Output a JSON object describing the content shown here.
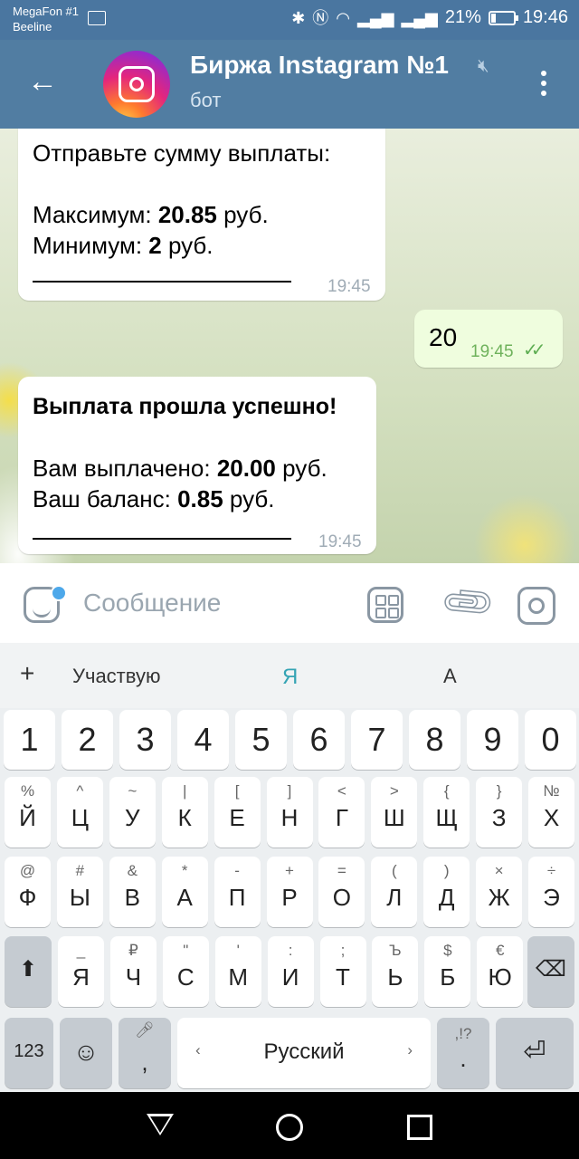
{
  "status_bar": {
    "carrier1": "MegaFon #1",
    "carrier2": "Beeline",
    "battery": "21%",
    "time": "19:46"
  },
  "header": {
    "title": "Биржа Instagram №1",
    "subtitle": "бот"
  },
  "messages": [
    {
      "from": "bot",
      "lines": [
        "Отправьте сумму выплаты:"
      ],
      "max_label": "Максимум: ",
      "max_value": "20.85",
      "min_label": "Минимум: ",
      "min_value": "2",
      "currency": " руб.",
      "time": "19:45"
    },
    {
      "from": "me",
      "text": "20",
      "time": "19:45"
    },
    {
      "from": "bot",
      "title": "Выплата прошла успешно!",
      "paid_label": "Вам выплачено: ",
      "paid_value": "20.00",
      "balance_label": "Ваш баланс: ",
      "balance_value": "0.85",
      "currency": " руб.",
      "time": "19:45"
    }
  ],
  "input": {
    "placeholder": "Сообщение"
  },
  "keyboard": {
    "suggestions": [
      "+",
      "Участвую",
      "Я",
      "А"
    ],
    "row_numbers": [
      "1",
      "2",
      "3",
      "4",
      "5",
      "6",
      "7",
      "8",
      "9",
      "0"
    ],
    "row1": [
      {
        "hint": "%",
        "key": "Й"
      },
      {
        "hint": "^",
        "key": "Ц"
      },
      {
        "hint": "~",
        "key": "У"
      },
      {
        "hint": "|",
        "key": "К"
      },
      {
        "hint": "[",
        "key": "Е"
      },
      {
        "hint": "]",
        "key": "Н"
      },
      {
        "hint": "<",
        "key": "Г"
      },
      {
        "hint": ">",
        "key": "Ш"
      },
      {
        "hint": "{",
        "key": "Щ"
      },
      {
        "hint": "}",
        "key": "З"
      },
      {
        "hint": "№",
        "key": "Х"
      }
    ],
    "row2": [
      {
        "hint": "@",
        "key": "Ф"
      },
      {
        "hint": "#",
        "key": "Ы"
      },
      {
        "hint": "&",
        "key": "В"
      },
      {
        "hint": "*",
        "key": "А"
      },
      {
        "hint": "-",
        "key": "П"
      },
      {
        "hint": "+",
        "key": "Р"
      },
      {
        "hint": "=",
        "key": "О"
      },
      {
        "hint": "(",
        "key": "Л"
      },
      {
        "hint": ")",
        "key": "Д"
      },
      {
        "hint": "×",
        "key": "Ж"
      },
      {
        "hint": "÷",
        "key": "Э"
      }
    ],
    "row3": [
      {
        "hint": "_",
        "key": "Я"
      },
      {
        "hint": "₽",
        "key": "Ч"
      },
      {
        "hint": "\"",
        "key": "С"
      },
      {
        "hint": "'",
        "key": "М"
      },
      {
        "hint": ":",
        "key": "И"
      },
      {
        "hint": ";",
        "key": "Т"
      },
      {
        "hint": "Ъ",
        "key": "Ь"
      },
      {
        "hint": "$",
        "key": "Б"
      },
      {
        "hint": "€",
        "key": "Ю"
      }
    ],
    "key_123": "123",
    "comma": ",",
    "space_label": "Русский",
    "period": ".",
    "period_hint": ",!?"
  }
}
